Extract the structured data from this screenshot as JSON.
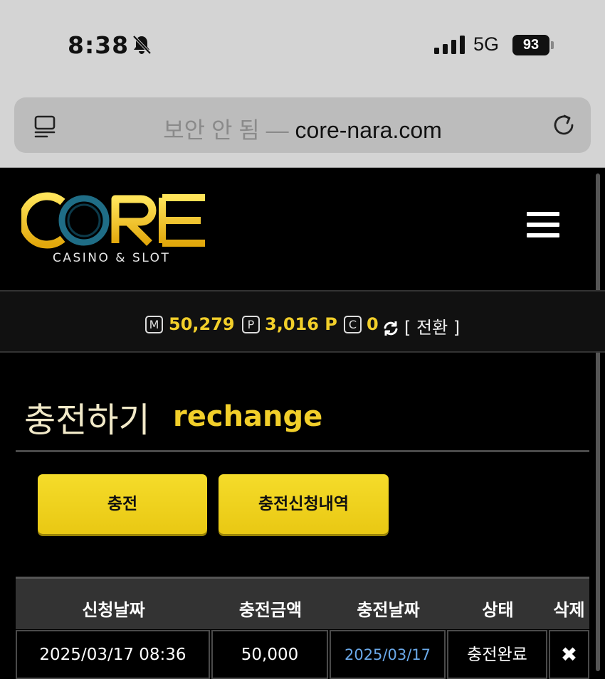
{
  "status_bar": {
    "time": "8:38",
    "network": "5G",
    "battery": "93"
  },
  "browser": {
    "secure_label": "보안 안 됨 — ",
    "domain": "core-nara.com"
  },
  "header": {
    "logo_main": "CORE",
    "logo_sub": "CASINO & SLOT"
  },
  "balance": {
    "money_badge": "M",
    "money": "50,279",
    "point_badge": "P",
    "point": "3,016 P",
    "coin_badge": "C",
    "coin": "0",
    "switch_label": "[ 전환 ]"
  },
  "page": {
    "title_ko": "충전하기",
    "title_en": "rechange"
  },
  "buttons": {
    "charge": "충전",
    "history": "충전신청내역"
  },
  "table": {
    "headers": [
      "신청날짜",
      "충전금액",
      "충전날짜",
      "상태",
      "삭제"
    ],
    "rows": [
      {
        "request_date": "2025/03/17 08:36",
        "amount": "50,000",
        "charge_date": "2025/03/17",
        "status": "충전완료",
        "delete": "✖"
      }
    ]
  },
  "colors": {
    "accent": "#f2cf2a",
    "button": "#f0d21e",
    "link_date": "#6aa8e8",
    "background": "#000000"
  }
}
